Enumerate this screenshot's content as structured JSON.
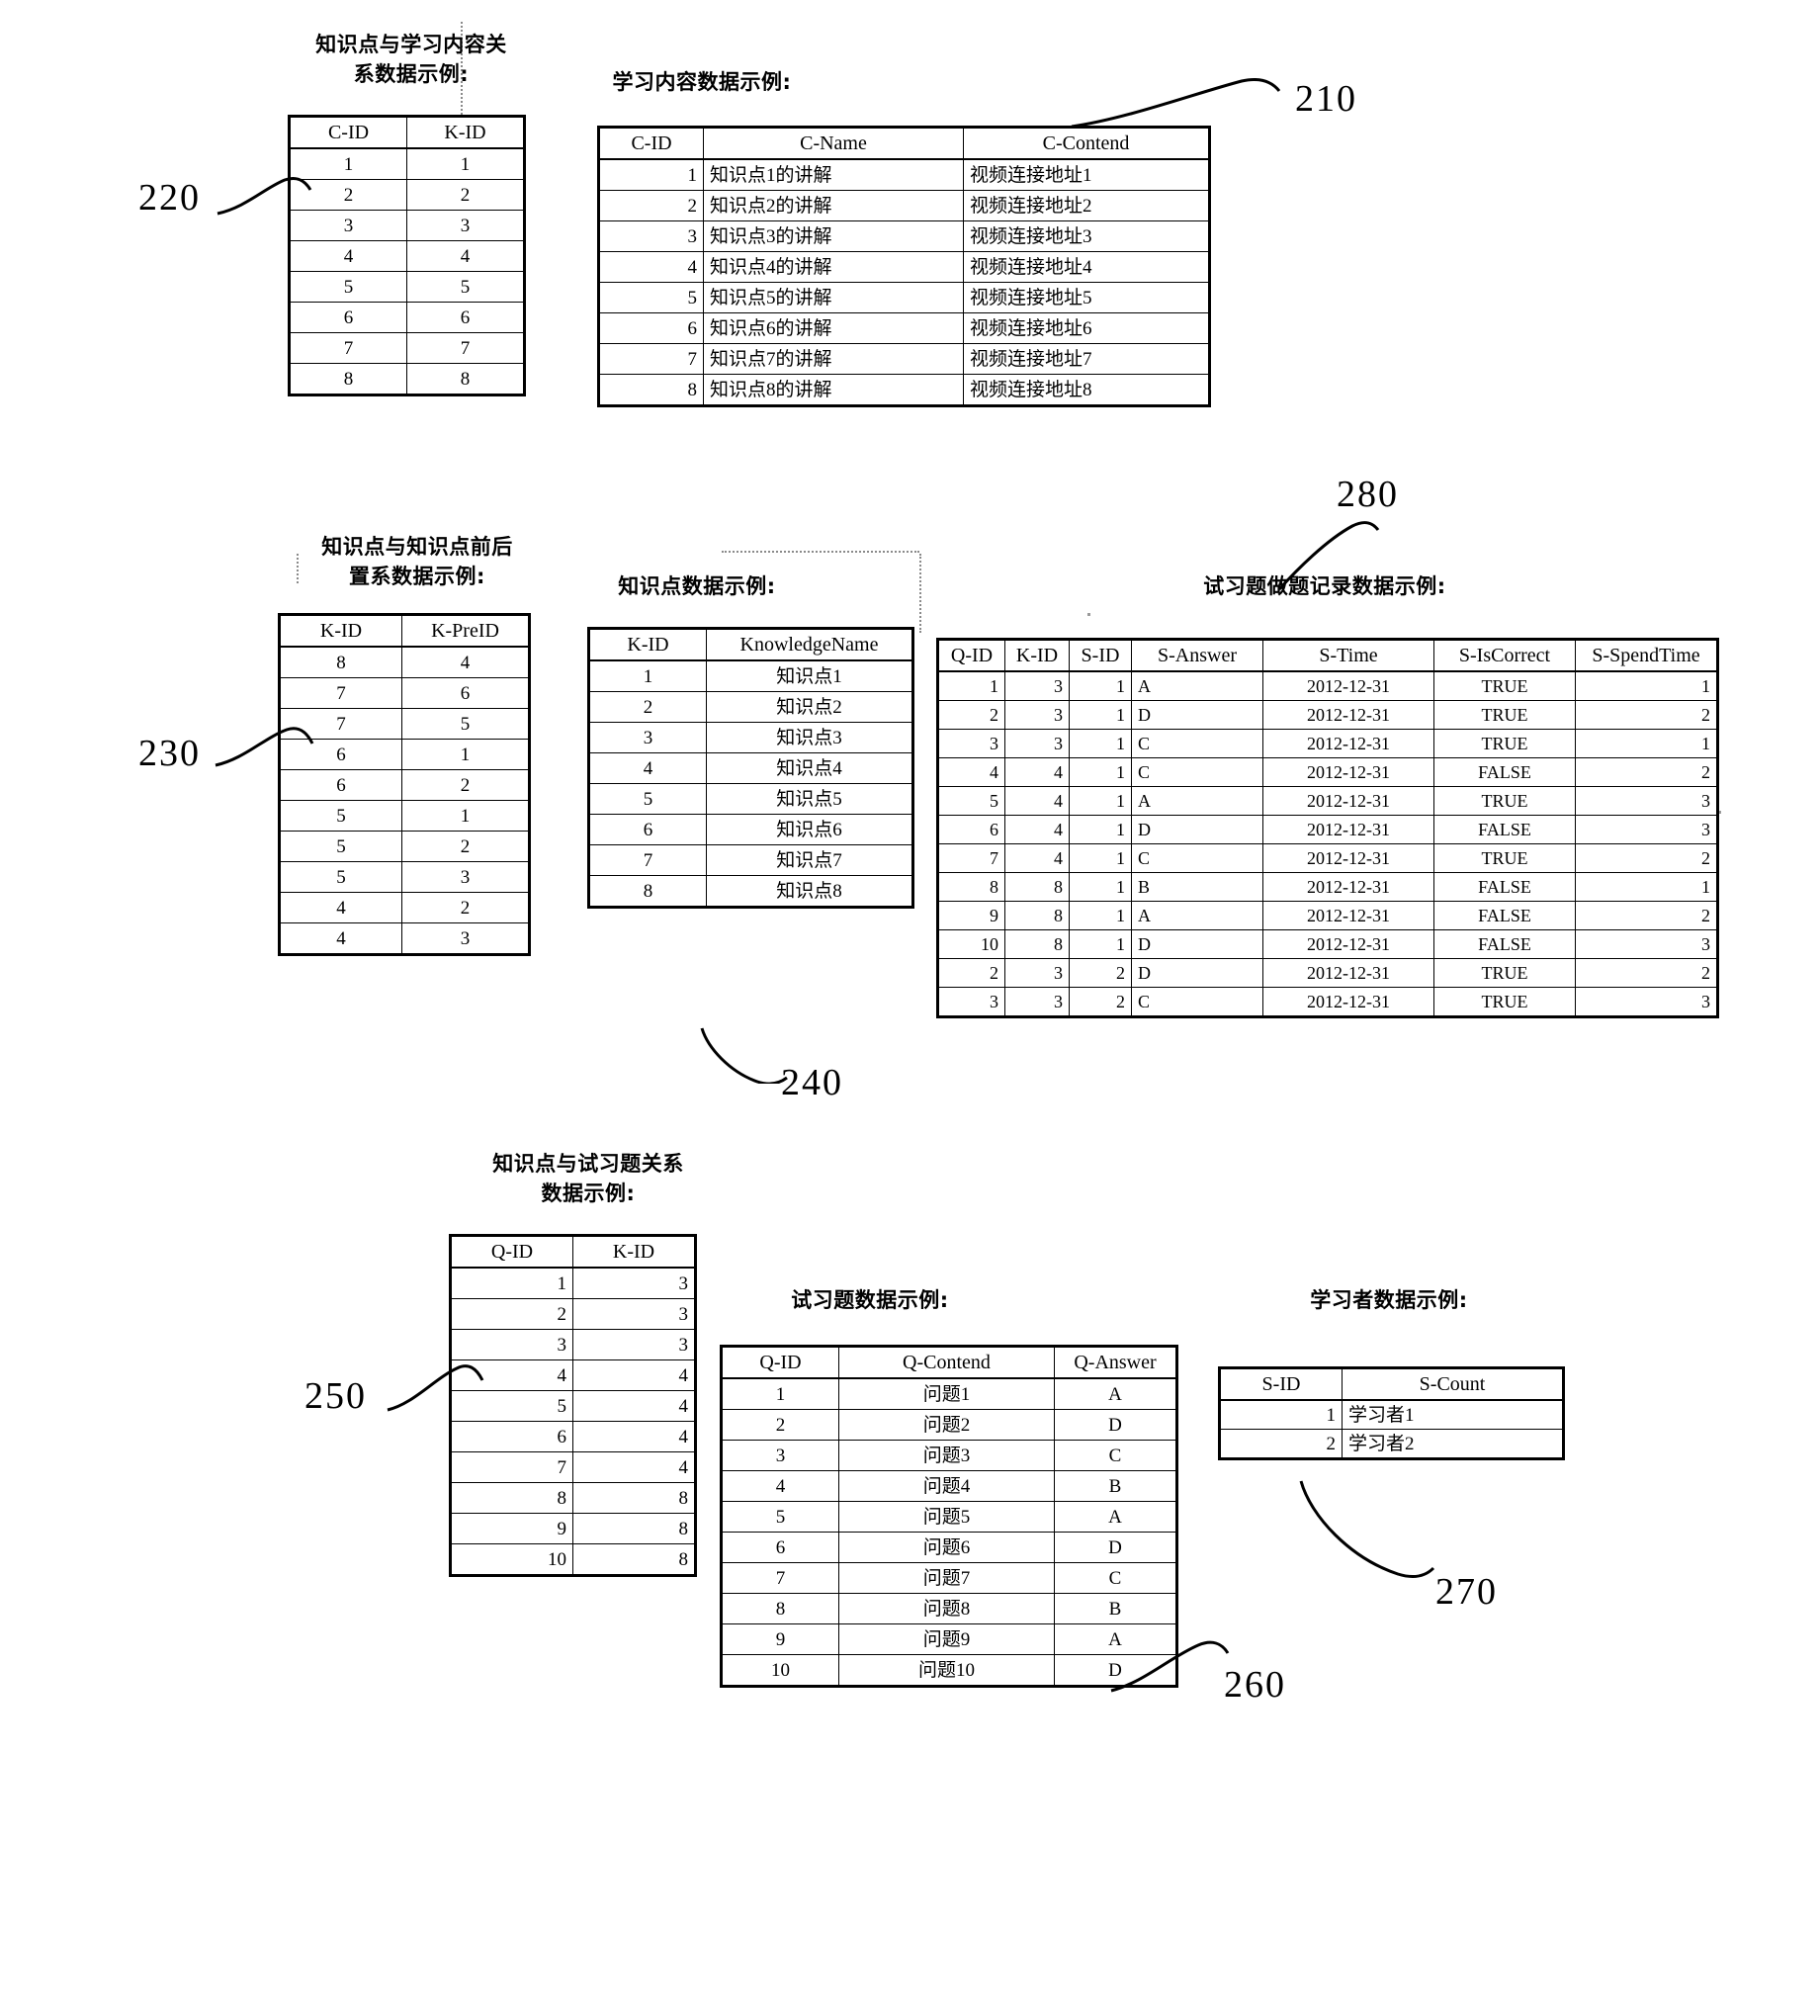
{
  "figure": {
    "ref_labels": [
      "210",
      "220",
      "230",
      "240",
      "250",
      "260",
      "270",
      "280"
    ]
  },
  "tables": {
    "kc_relation": {
      "ref": "220",
      "title_line1": "知识点与学习内容关",
      "title_line2": "系数据示例:",
      "columns": [
        "C-ID",
        "K-ID"
      ],
      "rows": [
        [
          "1",
          "1"
        ],
        [
          "2",
          "2"
        ],
        [
          "3",
          "3"
        ],
        [
          "4",
          "4"
        ],
        [
          "5",
          "5"
        ],
        [
          "6",
          "6"
        ],
        [
          "7",
          "7"
        ],
        [
          "8",
          "8"
        ]
      ]
    },
    "learning_content": {
      "ref": "210",
      "title_line1": "学习内容数据示例:",
      "columns": [
        "C-ID",
        "C-Name",
        "C-Contend"
      ],
      "rows": [
        [
          "1",
          "知识点1的讲解",
          "视频连接地址1"
        ],
        [
          "2",
          "知识点2的讲解",
          "视频连接地址2"
        ],
        [
          "3",
          "知识点3的讲解",
          "视频连接地址3"
        ],
        [
          "4",
          "知识点4的讲解",
          "视频连接地址4"
        ],
        [
          "5",
          "知识点5的讲解",
          "视频连接地址5"
        ],
        [
          "6",
          "知识点6的讲解",
          "视频连接地址6"
        ],
        [
          "7",
          "知识点7的讲解",
          "视频连接地址7"
        ],
        [
          "8",
          "知识点8的讲解",
          "视频连接地址8"
        ]
      ]
    },
    "knowledge_prereq": {
      "ref": "230",
      "title_line1": "知识点与知识点前后",
      "title_line2": "置系数据示例:",
      "columns": [
        "K-ID",
        "K-PreID"
      ],
      "rows": [
        [
          "8",
          "4"
        ],
        [
          "7",
          "6"
        ],
        [
          "7",
          "5"
        ],
        [
          "6",
          "1"
        ],
        [
          "6",
          "2"
        ],
        [
          "5",
          "1"
        ],
        [
          "5",
          "2"
        ],
        [
          "5",
          "3"
        ],
        [
          "4",
          "2"
        ],
        [
          "4",
          "3"
        ]
      ]
    },
    "knowledge": {
      "ref": "240",
      "title_line1": "知识点数据示例:",
      "columns": [
        "K-ID",
        "KnowledgeName"
      ],
      "rows": [
        [
          "1",
          "知识点1"
        ],
        [
          "2",
          "知识点2"
        ],
        [
          "3",
          "知识点3"
        ],
        [
          "4",
          "知识点4"
        ],
        [
          "5",
          "知识点5"
        ],
        [
          "6",
          "知识点6"
        ],
        [
          "7",
          "知识点7"
        ],
        [
          "8",
          "知识点8"
        ]
      ]
    },
    "exercise_record": {
      "ref": "280",
      "title_line1": "试习题做题记录数据示例:",
      "columns": [
        "Q-ID",
        "K-ID",
        "S-ID",
        "S-Answer",
        "S-Time",
        "S-IsCorrect",
        "S-SpendTime"
      ],
      "rows": [
        [
          "1",
          "3",
          "1",
          "A",
          "2012-12-31",
          "TRUE",
          "1"
        ],
        [
          "2",
          "3",
          "1",
          "D",
          "2012-12-31",
          "TRUE",
          "2"
        ],
        [
          "3",
          "3",
          "1",
          "C",
          "2012-12-31",
          "TRUE",
          "1"
        ],
        [
          "4",
          "4",
          "1",
          "C",
          "2012-12-31",
          "FALSE",
          "2"
        ],
        [
          "5",
          "4",
          "1",
          "A",
          "2012-12-31",
          "TRUE",
          "3"
        ],
        [
          "6",
          "4",
          "1",
          "D",
          "2012-12-31",
          "FALSE",
          "3"
        ],
        [
          "7",
          "4",
          "1",
          "C",
          "2012-12-31",
          "TRUE",
          "2"
        ],
        [
          "8",
          "8",
          "1",
          "B",
          "2012-12-31",
          "FALSE",
          "1"
        ],
        [
          "9",
          "8",
          "1",
          "A",
          "2012-12-31",
          "FALSE",
          "2"
        ],
        [
          "10",
          "8",
          "1",
          "D",
          "2012-12-31",
          "FALSE",
          "3"
        ],
        [
          "2",
          "3",
          "2",
          "D",
          "2012-12-31",
          "TRUE",
          "2"
        ],
        [
          "3",
          "3",
          "2",
          "C",
          "2012-12-31",
          "TRUE",
          "3"
        ]
      ]
    },
    "knowledge_exercise": {
      "ref": "250",
      "title_line1": "知识点与试习题关系",
      "title_line2": "数据示例:",
      "columns": [
        "Q-ID",
        "K-ID"
      ],
      "rows": [
        [
          "1",
          "3"
        ],
        [
          "2",
          "3"
        ],
        [
          "3",
          "3"
        ],
        [
          "4",
          "4"
        ],
        [
          "5",
          "4"
        ],
        [
          "6",
          "4"
        ],
        [
          "7",
          "4"
        ],
        [
          "8",
          "8"
        ],
        [
          "9",
          "8"
        ],
        [
          "10",
          "8"
        ]
      ]
    },
    "exercise": {
      "ref": "260",
      "title_line1": "试习题数据示例:",
      "columns": [
        "Q-ID",
        "Q-Contend",
        "Q-Answer"
      ],
      "rows": [
        [
          "1",
          "问题1",
          "A"
        ],
        [
          "2",
          "问题2",
          "D"
        ],
        [
          "3",
          "问题3",
          "C"
        ],
        [
          "4",
          "问题4",
          "B"
        ],
        [
          "5",
          "问题5",
          "A"
        ],
        [
          "6",
          "问题6",
          "D"
        ],
        [
          "7",
          "问题7",
          "C"
        ],
        [
          "8",
          "问题8",
          "B"
        ],
        [
          "9",
          "问题9",
          "A"
        ],
        [
          "10",
          "问题10",
          "D"
        ]
      ]
    },
    "learner": {
      "ref": "270",
      "title_line1": "学习者数据示例:",
      "columns": [
        "S-ID",
        "S-Count"
      ],
      "rows": [
        [
          "1",
          "学习者1"
        ],
        [
          "2",
          "学习者2"
        ]
      ]
    }
  }
}
